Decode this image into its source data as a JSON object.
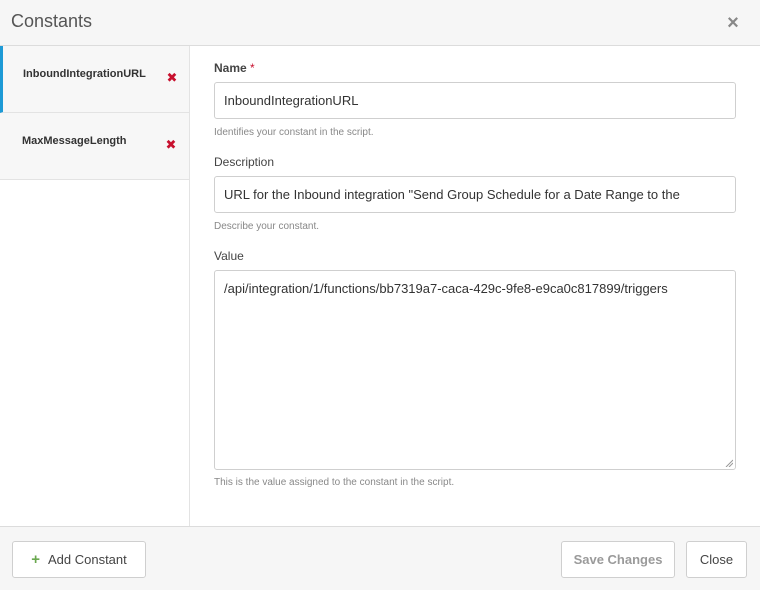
{
  "dialog": {
    "title": "Constants",
    "close_glyph": "×"
  },
  "sidebar": {
    "items": [
      {
        "label": "InboundIntegrationURL",
        "active": true,
        "delete_glyph": "✖"
      },
      {
        "label": "MaxMessageLength",
        "active": false,
        "delete_glyph": "✖"
      }
    ]
  },
  "form": {
    "name": {
      "label": "Name",
      "required_mark": "*",
      "value": "InboundIntegrationURL",
      "help": "Identifies your constant in the script."
    },
    "description": {
      "label": "Description",
      "value": "URL for the Inbound integration \"Send Group Schedule for a Date Range to the",
      "help": "Describe your constant."
    },
    "value": {
      "label": "Value",
      "value": "/api/integration/1/functions/bb7319a7-caca-429c-9fe8-e9ca0c817899/triggers",
      "help": "This is the value assigned to the constant in the script."
    }
  },
  "footer": {
    "add_label": "Add Constant",
    "add_icon": "+",
    "save_label": "Save Changes",
    "close_label": "Close"
  },
  "colors": {
    "accent": "#1e9ad6",
    "delete": "#c8102e",
    "add_icon": "#6aa84f"
  }
}
